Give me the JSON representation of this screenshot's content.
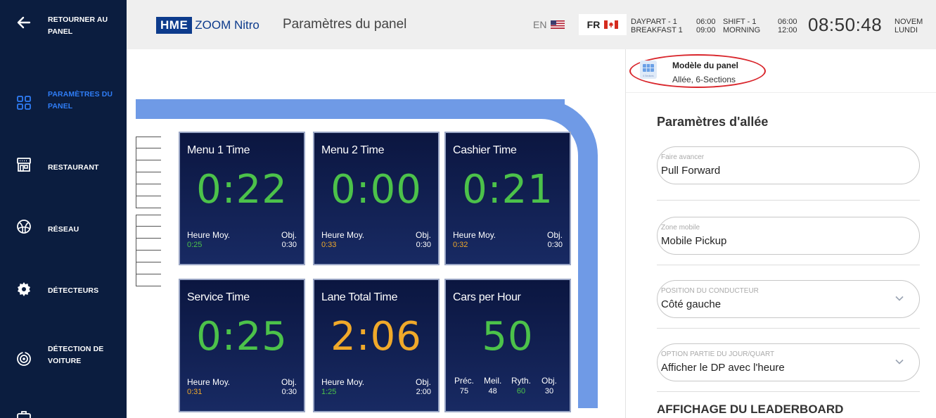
{
  "sidebar": {
    "back_label": "RETOURNER AU PANEL",
    "items": [
      {
        "label": "PARAMÈTRES DU PANEL",
        "icon": "grid-icon",
        "active": true
      },
      {
        "label": "RESTAURANT",
        "icon": "storefront-icon",
        "active": false
      },
      {
        "label": "RÉSEAU",
        "icon": "network-globe-icon",
        "active": false
      },
      {
        "label": "DÉTECTEURS",
        "icon": "gear-icon",
        "active": false
      },
      {
        "label": "DÉTECTION DE VOITURE",
        "icon": "car-detection-icon",
        "active": false
      }
    ]
  },
  "header": {
    "logo_hme": "HME",
    "logo_product": "ZOOM Nitro",
    "title": "Paramètres du panel",
    "lang_en": "EN",
    "lang_fr": "FR",
    "daypart_label": "DAYPART - 1",
    "daypart_name": "BREAKFAST 1",
    "daypart_start": "06:00",
    "daypart_end": "09:00",
    "shift_label": "SHIFT - 1",
    "shift_name": "MORNING",
    "shift_start": "06:00",
    "shift_end": "12:00",
    "clock": "08:50:48",
    "date_month": "NOVEM",
    "date_day": "LUNDI"
  },
  "tiles": [
    {
      "title": "Menu 1 Time",
      "value": "0:22",
      "value_color": "green",
      "avg_label": "Heure Moy.",
      "avg": "0:25",
      "avg_color": "green",
      "obj_label": "Obj.",
      "obj": "0:30"
    },
    {
      "title": "Menu 2 Time",
      "value": "0:00",
      "value_color": "green",
      "avg_label": "Heure Moy.",
      "avg": "0:33",
      "avg_color": "amber",
      "obj_label": "Obj.",
      "obj": "0:30"
    },
    {
      "title": "Cashier Time",
      "value": "0:21",
      "value_color": "green",
      "avg_label": "Heure Moy.",
      "avg": "0:32",
      "avg_color": "amber",
      "obj_label": "Obj.",
      "obj": "0:30"
    },
    {
      "title": "Service Time",
      "value": "0:25",
      "value_color": "green",
      "avg_label": "Heure Moy.",
      "avg": "0:31",
      "avg_color": "amber",
      "obj_label": "Obj.",
      "obj": "0:30"
    },
    {
      "title": "Lane Total Time",
      "value": "2:06",
      "value_color": "amber",
      "avg_label": "Heure Moy.",
      "avg": "1:25",
      "avg_color": "green",
      "obj_label": "Obj.",
      "obj": "2:00"
    }
  ],
  "cars_tile": {
    "title": "Cars per Hour",
    "value": "50",
    "stats": [
      {
        "label": "Préc.",
        "value": "75",
        "color": "white"
      },
      {
        "label": "Meil.",
        "value": "48",
        "color": "white"
      },
      {
        "label": "Ryth.",
        "value": "60",
        "color": "green"
      },
      {
        "label": "Obj.",
        "value": "30",
        "color": "white"
      }
    ]
  },
  "panel": {
    "model_title": "Modèle du panel",
    "model_sub": "Allée, 6-Sections",
    "model_thumb_caption": "6 Sections",
    "section_title": "Paramètres d'allée",
    "fields": [
      {
        "label": "Faire avancer",
        "value": "Pull Forward",
        "dropdown": false
      },
      {
        "label": "Zone mobile",
        "value": "Mobile Pickup",
        "dropdown": false
      },
      {
        "label": "POSITION DU CONDUCTEUR",
        "value": "Côté gauche",
        "dropdown": true
      },
      {
        "label": "OPTION PARTIE DU JOUR/QUART",
        "value": "Afficher le DP avec l'heure",
        "dropdown": true
      }
    ],
    "leaderboard_title": "AFFICHAGE DU LEADERBOARD"
  },
  "colors": {
    "sidebar_bg": "#0b1d3f",
    "active_nav": "#2f7df6",
    "lane": "#6f9ae6",
    "tile_green": "#4cc24a",
    "tile_amber": "#f0a92a",
    "highlight_oval": "#d9262c"
  }
}
